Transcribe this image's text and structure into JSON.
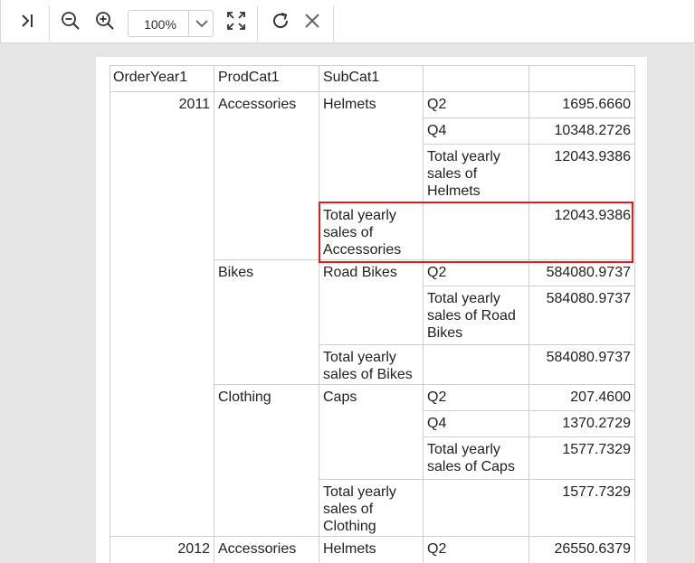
{
  "toolbar": {
    "zoom_value": "100%",
    "icons": [
      "goto-last-icon",
      "zoom-out-icon",
      "zoom-in-icon",
      "chevron-down-icon",
      "fit-page-icon",
      "refresh-icon",
      "close-icon"
    ]
  },
  "colors": {
    "highlight": "#e01e1e",
    "grid": "#cfcfcf",
    "background": "#e6e6e6"
  },
  "report": {
    "headers": [
      "OrderYear1",
      "ProdCat1",
      "SubCat1",
      "",
      ""
    ],
    "year_2011": "2011",
    "year_2012": "2012",
    "accessories": "Accessories",
    "accessories_2012": "Accessories",
    "helmets": "Helmets",
    "helmets_2012": "Helmets",
    "bikes": "Bikes",
    "road_bikes": "Road Bikes",
    "clothing": "Clothing",
    "caps": "Caps",
    "rows": {
      "helmets_q2": {
        "q": "Q2",
        "v": "1695.6660"
      },
      "helmets_q4": {
        "q": "Q4",
        "v": "10348.2726"
      },
      "helmets_total": {
        "label": "Total yearly sales of Helmets",
        "v": "12043.9386"
      },
      "accessories_total": {
        "label": "Total yearly sales of Accessories",
        "v": "12043.9386"
      },
      "roadbikes_q2": {
        "q": "Q2",
        "v": "584080.9737"
      },
      "roadbikes_total": {
        "label": "Total yearly sales of Road Bikes",
        "v": "584080.9737"
      },
      "bikes_total": {
        "label": "Total yearly sales of Bikes",
        "v": "584080.9737"
      },
      "caps_q2": {
        "q": "Q2",
        "v": "207.4600"
      },
      "caps_q4": {
        "q": "Q4",
        "v": "1370.2729"
      },
      "caps_total": {
        "label": "Total yearly sales of Caps",
        "v": "1577.7329"
      },
      "clothing_total": {
        "label": "Total yearly sales of Clothing",
        "v": "1577.7329"
      },
      "helmets2012_q2": {
        "q": "Q2",
        "v": "26550.6379"
      }
    }
  }
}
